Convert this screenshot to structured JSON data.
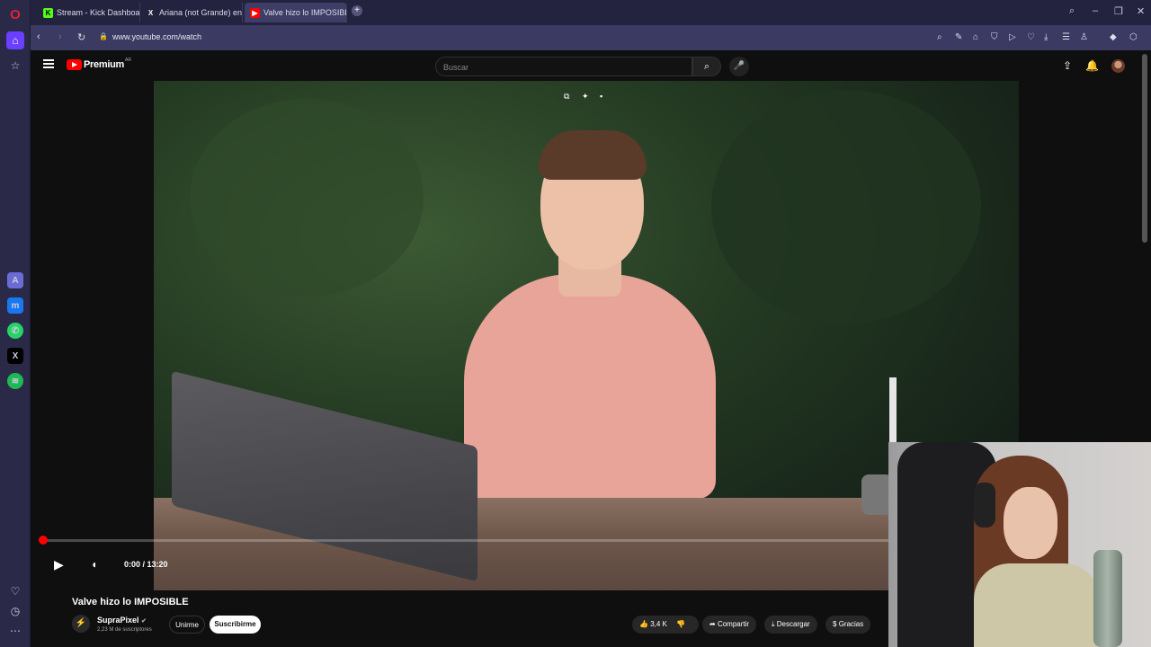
{
  "browser": {
    "tabs": [
      {
        "label": "Stream - Kick Dashboard",
        "favicon": "K",
        "color": "#53fc18"
      },
      {
        "label": "Ariana (not Grande) en X:",
        "favicon": "X",
        "color": "#000000"
      },
      {
        "label": "Valve hizo lo IMPOSIBLE",
        "favicon": "▶",
        "color": "#ff0000"
      }
    ],
    "url": "www.youtube.com/watch"
  },
  "youtube": {
    "logo_text": "Premium",
    "region": "AR",
    "search_placeholder": "Buscar"
  },
  "player": {
    "time": "0:00 / 13:20",
    "progress_fraction": 0.0
  },
  "video": {
    "title": "Valve hizo lo IMPOSIBLE",
    "channel_name": "SupraPixel",
    "channel_subs": "2,23 M de suscriptores",
    "join_label": "Unirme",
    "subscribe_label": "Suscribirme",
    "likes": "3,4 K",
    "share_label": "Compartir",
    "download_label": "Descargar",
    "thanks_label": "Gracias"
  },
  "colors": {
    "accent": "#ff0000",
    "opera_sidebar": "#2a2a48",
    "tab_bar": "#232340",
    "address_bar": "#3a3a62"
  }
}
